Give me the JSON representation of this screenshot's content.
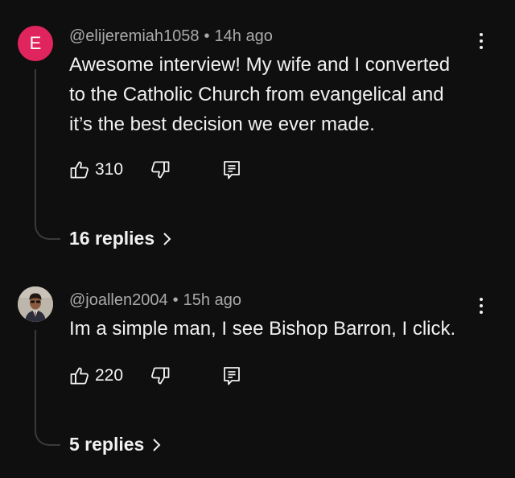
{
  "comments": [
    {
      "avatar_letter": "E",
      "avatar_color": "#e0245e",
      "handle": "@elijeremiah1058",
      "time": "14h ago",
      "lines": [
        "Awesome interview! My wife and I converted",
        "to the Catholic Church from evangelical and",
        "it’s the best decision we ever made."
      ],
      "likes": "310",
      "replies_label": "16 replies"
    },
    {
      "avatar_letter": "",
      "handle": "@joallen2004",
      "time": "15h ago",
      "lines": [
        "Im a simple man, I see Bishop Barron, I click."
      ],
      "likes": "220",
      "replies_label": "5 replies"
    }
  ],
  "icons": {
    "like": "thumbs-up-icon",
    "dislike": "thumbs-down-icon",
    "reply": "reply-comment-icon",
    "more": "more-vertical-icon",
    "chevron": "chevron-right-icon"
  }
}
